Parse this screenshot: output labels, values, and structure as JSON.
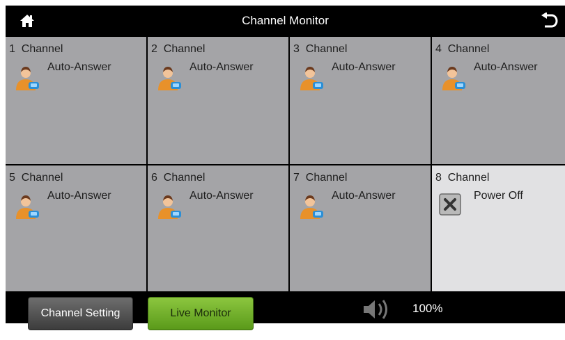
{
  "header": {
    "title": "Channel Monitor",
    "home_icon": "home-icon",
    "back_icon": "back-icon"
  },
  "channels": [
    {
      "label": "1  Channel",
      "status": "Auto-Answer",
      "icon": "agent-icon"
    },
    {
      "label": "2  Channel",
      "status": "Auto-Answer",
      "icon": "agent-icon"
    },
    {
      "label": "3  Channel",
      "status": "Auto-Answer",
      "icon": "agent-icon"
    },
    {
      "label": "4  Channel",
      "status": "Auto-Answer",
      "icon": "agent-icon"
    },
    {
      "label": "5  Channel",
      "status": "Auto-Answer",
      "icon": "agent-icon"
    },
    {
      "label": "6  Channel",
      "status": "Auto-Answer",
      "icon": "agent-icon"
    },
    {
      "label": "7  Channel",
      "status": "Auto-Answer",
      "icon": "agent-icon"
    },
    {
      "label": "8  Channel",
      "status": "Power Off",
      "icon": "power-off-icon"
    }
  ],
  "footer": {
    "channel_setting_label": "Channel Setting",
    "live_monitor_label": "Live Monitor",
    "volume_icon": "speaker-icon",
    "volume_text": "100%"
  },
  "colors": {
    "background": "#000000",
    "cell_active": "#a4a4a7",
    "cell_off": "#e1e1e3",
    "live_monitor_green": "#7ab32e",
    "channel_setting_gray": "#555555"
  }
}
